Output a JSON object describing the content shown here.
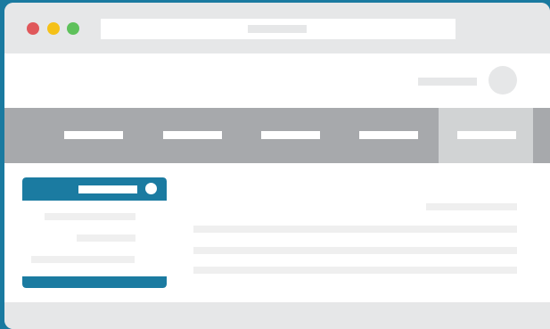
{
  "colors": {
    "background": "#1a7aa0",
    "window_chrome": "#e6e7e8",
    "close_dot": "#e0585b",
    "minimize_dot": "#f5c118",
    "zoom_dot": "#5ec15b",
    "nav_bar": "#a7a9ac",
    "nav_active": "#d1d3d4",
    "card_accent": "#1b7ba1",
    "placeholder_text": "#efefef"
  },
  "titlebar": {
    "buttons": [
      "close",
      "minimize",
      "zoom"
    ],
    "address_bar": {
      "value": ""
    }
  },
  "header": {
    "user_name": "",
    "avatar_icon": "user-avatar-icon"
  },
  "nav": {
    "active_index": 4,
    "items": [
      {
        "label": ""
      },
      {
        "label": ""
      },
      {
        "label": ""
      },
      {
        "label": ""
      },
      {
        "label": ""
      }
    ]
  },
  "card": {
    "title": "",
    "close_icon": "close-icon",
    "lines": [
      "",
      "",
      ""
    ]
  },
  "main": {
    "heading": "",
    "lines": [
      "",
      "",
      ""
    ]
  }
}
